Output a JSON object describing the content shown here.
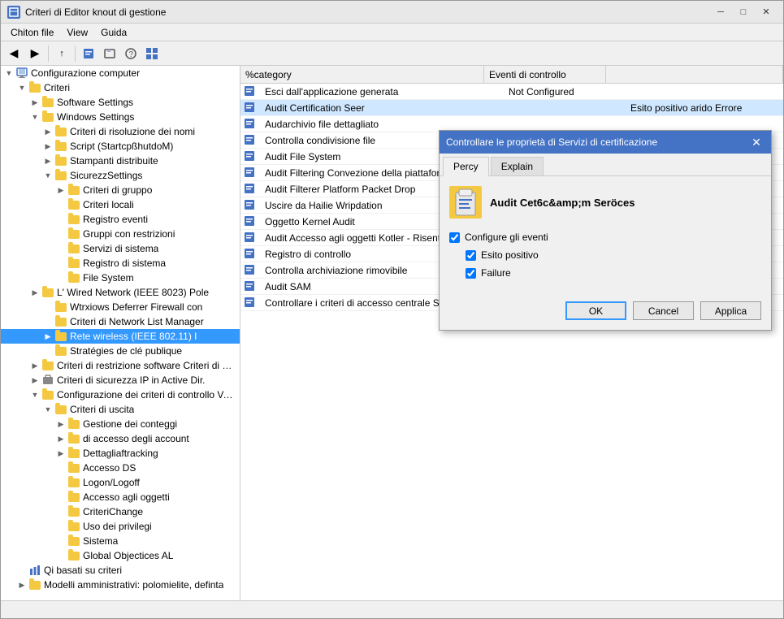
{
  "titleBar": {
    "title": "Criteri di Editor knout di gestione",
    "minimizeLabel": "─",
    "maximizeLabel": "□",
    "closeLabel": "✕"
  },
  "menuBar": {
    "items": [
      "Chiton file",
      "View",
      "Guida"
    ]
  },
  "toolbar": {
    "buttons": [
      "◀",
      "▶",
      "↑",
      "✕",
      "📁",
      "⧉",
      "?",
      "⊞"
    ]
  },
  "treePanel": {
    "root": "Configurazione computer",
    "items": [
      {
        "level": 1,
        "label": "Criteri",
        "expanded": true,
        "type": "folder"
      },
      {
        "level": 2,
        "label": "Software Settings",
        "expanded": false,
        "type": "folder"
      },
      {
        "level": 2,
        "label": "Windows Settings",
        "expanded": true,
        "type": "folder"
      },
      {
        "level": 3,
        "label": "Criteri di risoluzione dei nomi",
        "expanded": false,
        "type": "folder"
      },
      {
        "level": 3,
        "label": "Script (StartcpßhutdoM)",
        "expanded": false,
        "type": "folder"
      },
      {
        "level": 3,
        "label": "Stampanti distribuite",
        "expanded": false,
        "type": "folder"
      },
      {
        "level": 3,
        "label": "SicurezzSettings",
        "expanded": true,
        "type": "folder"
      },
      {
        "level": 4,
        "label": "Criteri di gruppo",
        "expanded": false,
        "type": "folder"
      },
      {
        "level": 4,
        "label": "Criteri locali",
        "expanded": false,
        "type": "folder",
        "selected": false
      },
      {
        "level": 4,
        "label": "Registro eventi",
        "expanded": false,
        "type": "folder"
      },
      {
        "level": 4,
        "label": "Gruppi con restrizioni",
        "expanded": false,
        "type": "folder"
      },
      {
        "level": 4,
        "label": "Servizi di sistema",
        "expanded": false,
        "type": "folder"
      },
      {
        "level": 4,
        "label": "Registro di sistema",
        "expanded": false,
        "type": "folder"
      },
      {
        "level": 4,
        "label": "File System",
        "expanded": false,
        "type": "folder"
      },
      {
        "level": 2,
        "label": "L' Wired Network (IEEE 8023) Pole",
        "expanded": false,
        "type": "folder"
      },
      {
        "level": 3,
        "label": "Wtrxiows Deferrer Firewall con",
        "expanded": false,
        "type": "folder"
      },
      {
        "level": 3,
        "label": "Criteri di Network List Manager",
        "expanded": false,
        "type": "folder"
      },
      {
        "level": 3,
        "label": "Rete wireless (IEEE 802.11) I",
        "expanded": false,
        "type": "folder",
        "selected": true
      },
      {
        "level": 3,
        "label": "Stratégies de clé publique",
        "expanded": false,
        "type": "folder"
      },
      {
        "level": 2,
        "label": "Criteri di restrizione software Criteri di controllo delle applicazioni",
        "expanded": false,
        "type": "folder"
      },
      {
        "level": 2,
        "label": "Criteri di sicurezza IP in Active Dir.",
        "expanded": false,
        "type": "folder"
      },
      {
        "level": 2,
        "label": "Configurazione dei criteri di controllo Vance",
        "expanded": true,
        "type": "folder"
      },
      {
        "level": 3,
        "label": "Criteri di uscita",
        "expanded": true,
        "type": "folder"
      },
      {
        "level": 4,
        "label": "Gestione dei conteggi",
        "expanded": false,
        "type": "folder"
      },
      {
        "level": 4,
        "label": "di accesso degli account",
        "expanded": false,
        "type": "folder"
      },
      {
        "level": 4,
        "label": "Dettagliaftracking",
        "expanded": false,
        "type": "folder"
      },
      {
        "level": 4,
        "label": "Accesso DS",
        "expanded": false,
        "type": "folder"
      },
      {
        "level": 4,
        "label": "Logon/Logoff",
        "expanded": false,
        "type": "folder"
      },
      {
        "level": 4,
        "label": "Accesso agli oggetti",
        "expanded": false,
        "type": "folder"
      },
      {
        "level": 4,
        "label": "CriteriChange",
        "expanded": false,
        "type": "folder"
      },
      {
        "level": 4,
        "label": "Uso dei privilegi",
        "expanded": false,
        "type": "folder"
      },
      {
        "level": 4,
        "label": "Sistema",
        "expanded": false,
        "type": "folder"
      },
      {
        "level": 4,
        "label": "Global Objectices AL",
        "expanded": false,
        "type": "folder"
      }
    ],
    "footer1": "Qi basati su criteri",
    "footer2": "Modelli amministrativi: polomielite, definta"
  },
  "listPanel": {
    "columns": [
      {
        "label": "%category"
      },
      {
        "label": "Eventi di controllo"
      },
      {
        "label": ""
      }
    ],
    "items": [
      {
        "icon": "policy",
        "name": "Esci dall'applicazione generata",
        "status": "Not Configured",
        "extra": ""
      },
      {
        "icon": "policy",
        "name": "Audit Certification Seer",
        "status": "",
        "extra": "Esito positivo arido Errore",
        "highlighted": true
      },
      {
        "icon": "policy",
        "name": "Audarchivio file dettagliato",
        "status": "",
        "extra": ""
      },
      {
        "icon": "policy",
        "name": "Controlla condivisione file",
        "status": "",
        "extra": ""
      },
      {
        "icon": "policy",
        "name": "Audit File System",
        "status": "",
        "extra": ""
      },
      {
        "icon": "policy",
        "name": "Audit Filtering Convezione della piattaforma",
        "status": "",
        "extra": ""
      },
      {
        "icon": "policy",
        "name": "Audit Filterer Platform Packet Drop",
        "status": "",
        "extra": ""
      },
      {
        "icon": "policy",
        "name": "Uscire da Hailie Wripdation",
        "status": "",
        "extra": ""
      },
      {
        "icon": "policy",
        "name": "Oggetto Kernel Audit",
        "status": "",
        "extra": ""
      },
      {
        "icon": "policy",
        "name": "Audit Accesso agli oggetti Kotler - Risentimento",
        "status": "",
        "extra": ""
      },
      {
        "icon": "policy",
        "name": "Registro di controllo",
        "status": "",
        "extra": ""
      },
      {
        "icon": "policy",
        "name": "Controlla archiviazione rimovibile",
        "status": "",
        "extra": ""
      },
      {
        "icon": "policy",
        "name": "Audit SAM",
        "status": "",
        "extra": ""
      },
      {
        "icon": "policy",
        "name": "Controllare i criteri di accesso centrale Stagira",
        "status": "",
        "extra": ""
      }
    ]
  },
  "dialog": {
    "title": "Controllare le proprietà di Servizi di certificazione",
    "tabs": [
      "Percy",
      "Explain"
    ],
    "activeTab": "Percy",
    "iconLabel": "Audit Cet6c&amp;m Seröces",
    "sectionLabel": "Configure gli eventi",
    "checkboxes": [
      {
        "label": "Configure gli eventi",
        "checked": true
      },
      {
        "label": "Esito positivo",
        "checked": true
      },
      {
        "label": "Failure",
        "checked": true
      }
    ],
    "buttons": [
      "OK",
      "Cancel",
      "Applica"
    ]
  }
}
